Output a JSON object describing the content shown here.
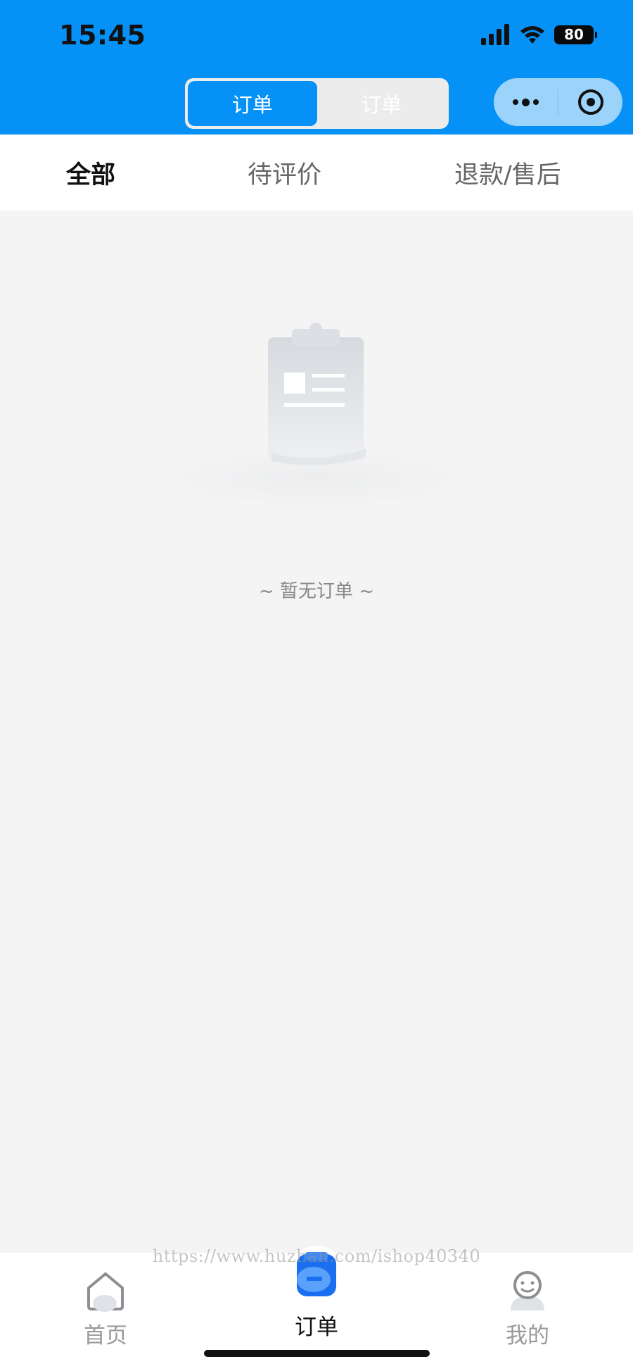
{
  "status_bar": {
    "time": "15:45",
    "battery": "80"
  },
  "header": {
    "segment": [
      "订单",
      "订单"
    ],
    "active_segment": 0
  },
  "tabs": [
    {
      "label": "全部",
      "active": true
    },
    {
      "label": "待评价",
      "active": false
    },
    {
      "label": "退款/售后",
      "active": false
    }
  ],
  "empty_state": {
    "message": "~ 暂无订单 ~",
    "icon": "clipboard-illustration"
  },
  "tab_bar": [
    {
      "label": "首页",
      "icon": "home-icon",
      "active": false
    },
    {
      "label": "订单",
      "icon": "order-icon",
      "active": true
    },
    {
      "label": "我的",
      "icon": "user-icon",
      "active": false
    }
  ],
  "watermark": "https://www.huzhan.com/ishop40340",
  "colors": {
    "primary": "#0591f6",
    "background": "#f4f4f5"
  }
}
